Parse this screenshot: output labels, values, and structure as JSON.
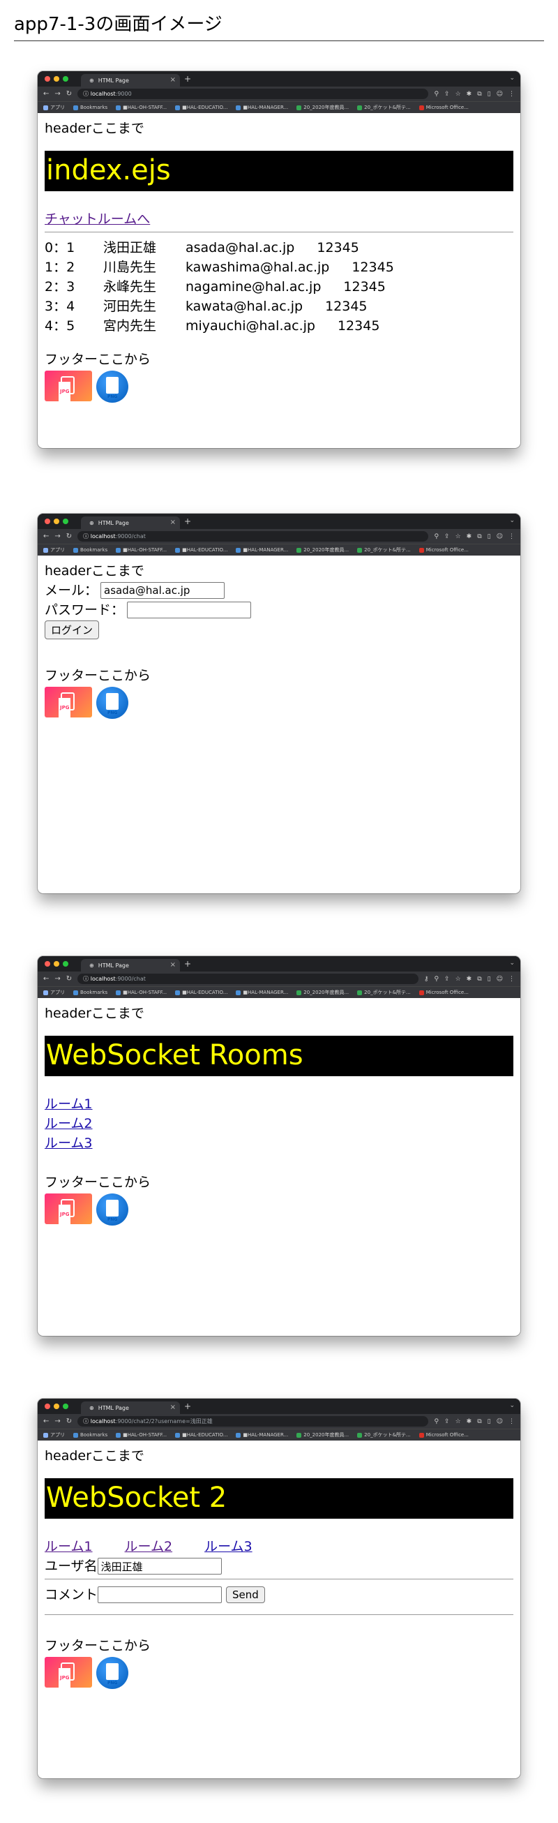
{
  "page_title": "app7-1-3の画面イメージ",
  "browser": {
    "tab_title": "HTML Page",
    "bookmarks": [
      "アプリ",
      "Bookmarks",
      "■HAL-OH-STAFF...",
      "■HAL-EDUCATIO...",
      "■HAL-MANAGER...",
      "20_2020年度教員...",
      "20_ポケット&所テ...",
      "Microsoft Office..."
    ]
  },
  "common": {
    "header_text": "headerここまで",
    "footer_text": "フッターここから",
    "jpg_badge": "JPG",
    "png_badge": "PNG"
  },
  "screen1": {
    "url_host": "localhost",
    "url_path": ":9000",
    "heading": "index.ejs",
    "chat_link": "チャットルームへ",
    "users": [
      {
        "index": "0：1",
        "name": "浅田正雄",
        "email": "asada@hal.ac.jp",
        "password": "12345"
      },
      {
        "index": "1：2",
        "name": "川島先生",
        "email": "kawashima@hal.ac.jp",
        "password": "12345"
      },
      {
        "index": "2：3",
        "name": "永峰先生",
        "email": "nagamine@hal.ac.jp",
        "password": "12345"
      },
      {
        "index": "3：4",
        "name": "河田先生",
        "email": "kawata@hal.ac.jp",
        "password": "12345"
      },
      {
        "index": "4：5",
        "name": "宮内先生",
        "email": "miyauchi@hal.ac.jp",
        "password": "12345"
      }
    ]
  },
  "screen2": {
    "url_host": "localhost",
    "url_path": ":9000/chat",
    "mail_label": "メール：",
    "mail_value": "asada@hal.ac.jp",
    "password_label": "パスワード：",
    "password_value": "",
    "login_button": "ログイン"
  },
  "screen3": {
    "url_host": "localhost",
    "url_path": ":9000/chat",
    "heading": "WebSocket Rooms",
    "rooms": [
      "ルーム1",
      "ルーム2",
      "ルーム3"
    ]
  },
  "screen4": {
    "url_host": "localhost",
    "url_path": ":9000/chat2/2?username=浅田正雄",
    "heading": "WebSocket 2",
    "rooms": [
      "ルーム1",
      "ルーム2",
      "ルーム3"
    ],
    "username_label": "ユーザ名",
    "username_value": "浅田正雄",
    "comment_label": "コメント",
    "comment_value": "",
    "send_button": "Send"
  }
}
